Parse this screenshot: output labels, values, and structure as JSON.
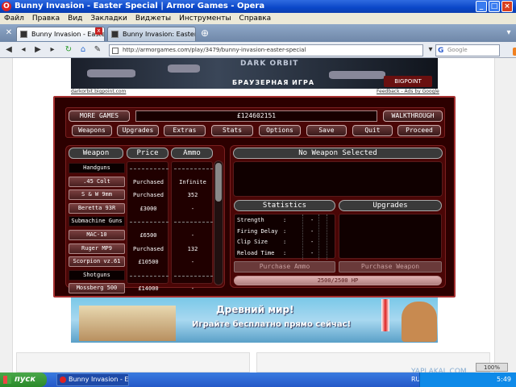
{
  "window": {
    "title": "Bunny Invasion - Easter Special | Armor Games - Opera"
  },
  "menu": {
    "items": [
      "Файл",
      "Правка",
      "Вид",
      "Закладки",
      "Виджеты",
      "Инструменты",
      "Справка"
    ]
  },
  "tabs": [
    {
      "label": "Bunny Invasion - Easter ..."
    },
    {
      "label": "Bunny Invasion: Easter ..."
    }
  ],
  "address": {
    "url": "http://armorgames.com/play/3479/bunny-invasion-easter-special",
    "search_placeholder": "Google"
  },
  "top_banner": {
    "logo_text": "DARK ORBIT",
    "subtitle": "БРАУЗЕРНАЯ ИГРА",
    "brand": "BIGPOINT",
    "left_link": "darkorbit.bigpoint.com",
    "right_link": "Feedback - Ads by Google"
  },
  "game": {
    "top_buttons": {
      "more_games": "MORE GAMES",
      "walkthrough": "WALKTHROUGH"
    },
    "money": "£124602151",
    "nav": [
      "Weapons",
      "Upgrades",
      "Extras",
      "Stats",
      "Options",
      "Save",
      "Quit",
      "Proceed"
    ],
    "columns": {
      "weapon": "Weapon",
      "price": "Price",
      "ammo": "Ammo"
    },
    "weapons": [
      {
        "type": "category",
        "name": "Handguns",
        "price": "",
        "ammo": ""
      },
      {
        "type": "item",
        "name": ".45 Colt",
        "price": "Purchased",
        "ammo": "Infinite"
      },
      {
        "type": "item",
        "name": "S & W 9mm",
        "price": "Purchased",
        "ammo": "352"
      },
      {
        "type": "item",
        "name": "Beretta 93R",
        "price": "£3000",
        "ammo": "-"
      },
      {
        "type": "category",
        "name": "Submachine Guns",
        "price": "",
        "ammo": ""
      },
      {
        "type": "item",
        "name": "MAC-10",
        "price": "£6500",
        "ammo": "-"
      },
      {
        "type": "item",
        "name": "Ruger MP9",
        "price": "Purchased",
        "ammo": "132"
      },
      {
        "type": "item",
        "name": "Scorpion vz.61",
        "price": "£10500",
        "ammo": "-"
      },
      {
        "type": "category",
        "name": "Shotguns",
        "price": "",
        "ammo": ""
      },
      {
        "type": "item",
        "name": "Mossberg 500",
        "price": "£14000",
        "ammo": "-"
      }
    ],
    "selected_header": "No Weapon Selected",
    "statistics_header": "Statistics",
    "upgrades_header": "Upgrades",
    "stats": [
      {
        "label": "Strength",
        "sep": ":",
        "value": "-"
      },
      {
        "label": "Firing Delay",
        "sep": ":",
        "value": "-"
      },
      {
        "label": "Clip Size",
        "sep": ":",
        "value": "-"
      },
      {
        "label": "Reload Time",
        "sep": ":",
        "value": "-"
      }
    ],
    "purchase_ammo": "Purchase Ammo",
    "purchase_weapon": "Purchase Weapon",
    "hp": "2500/2500 HP",
    "hp_fraction": 1.0
  },
  "bottom_banner": {
    "title": "Древний мир!",
    "subtitle": "Играйте бесплатно прямо сейчас!"
  },
  "taskbar": {
    "start": "пуск",
    "task": "Bunny Invasion - Eas...",
    "lang": "RU",
    "clock": "5:49",
    "zoom": "100%"
  },
  "watermark": "YAPLAKAL.COM",
  "colors": {
    "game_bg": "#2c0000",
    "game_border": "#a63030",
    "titlebar": "#0a46c8"
  }
}
